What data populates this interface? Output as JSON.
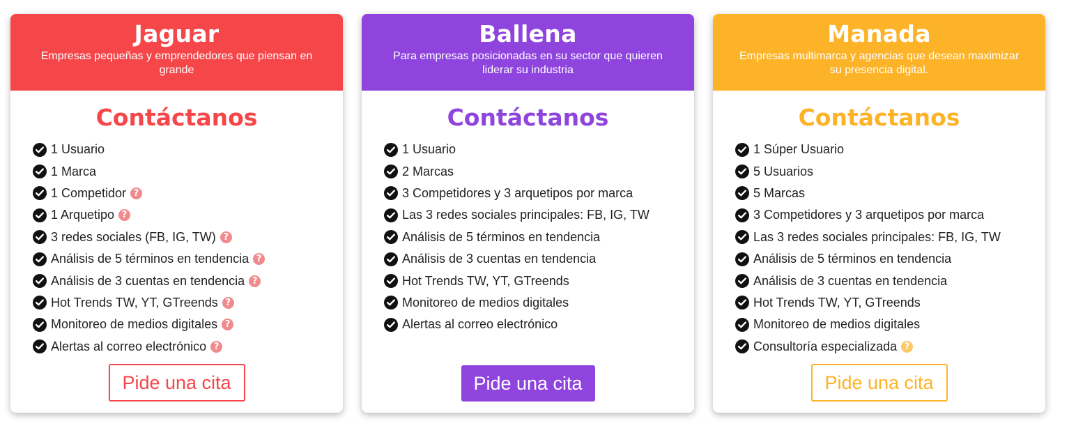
{
  "colors": {
    "red": "#f5464a",
    "purple": "#8e44dd",
    "orange": "#fdb328"
  },
  "plans": [
    {
      "name": "Jaguar",
      "description": "Empresas pequeñas y emprendedores que piensan en grande",
      "price": "Contáctanos",
      "cta": "Pide una cita",
      "features": [
        {
          "text": "1 Usuario",
          "help": false
        },
        {
          "text": "1 Marca",
          "help": false
        },
        {
          "text": "1 Competidor",
          "help": true
        },
        {
          "text": "1 Arquetipo",
          "help": true
        },
        {
          "text": "3 redes sociales (FB, IG, TW)",
          "help": true
        },
        {
          "text": "Análisis de 5 términos en tendencia",
          "help": true
        },
        {
          "text": "Análisis de 3 cuentas en tendencia",
          "help": true
        },
        {
          "text": "Hot Trends TW, YT, GTreends",
          "help": true
        },
        {
          "text": "Monitoreo de medios digitales",
          "help": true
        },
        {
          "text": "Alertas al correo electrónico",
          "help": true
        }
      ]
    },
    {
      "name": "Ballena",
      "description": "Para empresas posicionadas en su sector que quieren liderar su industria",
      "price": "Contáctanos",
      "cta": "Pide una cita",
      "features": [
        {
          "text": "1 Usuario",
          "help": false
        },
        {
          "text": "2 Marcas",
          "help": false
        },
        {
          "text": "3 Competidores y 3 arquetipos por marca",
          "help": false
        },
        {
          "text": "Las 3 redes sociales principales: FB, IG, TW",
          "help": false
        },
        {
          "text": "Análisis de 5 términos en tendencia",
          "help": false
        },
        {
          "text": "Análisis de 3 cuentas en tendencia",
          "help": false
        },
        {
          "text": "Hot Trends TW, YT, GTreends",
          "help": false
        },
        {
          "text": "Monitoreo de medios digitales",
          "help": false
        },
        {
          "text": "Alertas al correo electrónico",
          "help": false
        }
      ]
    },
    {
      "name": "Manada",
      "description": "Empresas multimarca y agencias que desean maximizar su presencia digital.",
      "price": "Contáctanos",
      "cta": "Pide una cita",
      "features": [
        {
          "text": "1 Súper Usuario",
          "help": false
        },
        {
          "text": "5 Usuarios",
          "help": false
        },
        {
          "text": "5 Marcas",
          "help": false
        },
        {
          "text": "3 Competidores y 3 arquetipos por marca",
          "help": false
        },
        {
          "text": "Las 3 redes sociales principales: FB, IG, TW",
          "help": false
        },
        {
          "text": "Análisis de 5 términos en tendencia",
          "help": false
        },
        {
          "text": "Análisis de 3 cuentas en tendencia",
          "help": false
        },
        {
          "text": "Hot Trends TW, YT, GTreends",
          "help": false
        },
        {
          "text": "Monitoreo de medios digitales",
          "help": false
        },
        {
          "text": "Consultoría especializada",
          "help": true
        }
      ]
    }
  ]
}
